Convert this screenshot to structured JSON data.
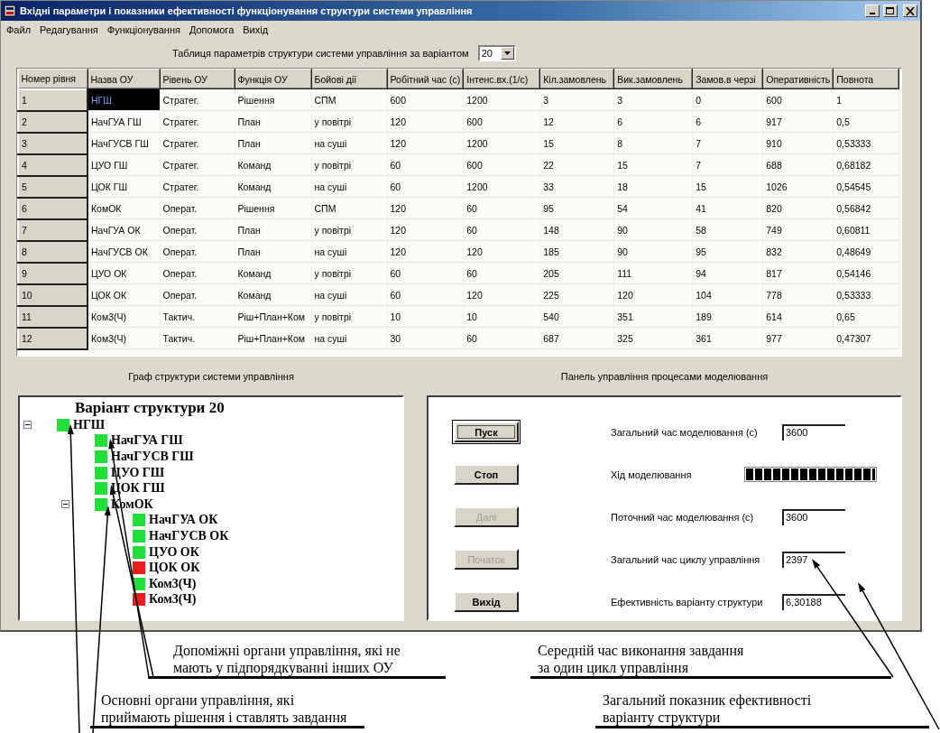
{
  "window": {
    "title": "Вхідні параметри і показники ефективності функціонування структури системи управління",
    "menu": [
      "Файл",
      "Редагування",
      "Функціонування",
      "Допомога",
      "Вихід"
    ]
  },
  "variant_selector": {
    "label": "Таблиця параметрів структури системи управління за варіантом",
    "value": "20"
  },
  "table": {
    "columns": [
      "Номер рівня",
      "Назва ОУ",
      "Рівень ОУ",
      "Функція ОУ",
      "Бойові дії",
      "Робітний час (с)",
      "Інтенс.вх.(1/с)",
      "Кіл.замовлень",
      "Вик.замовлень",
      "Замов.в черзі",
      "Оперативність",
      "Повнота"
    ],
    "rows": [
      {
        "selected": true,
        "cells": [
          "1",
          "НГШ",
          "Стратег.",
          "Рішення",
          "СПМ",
          "600",
          "1200",
          "3",
          "3",
          "0",
          "600",
          "1"
        ]
      },
      {
        "selected": false,
        "cells": [
          "2",
          "НачГУА ГШ",
          "Стратег.",
          "План",
          "у повітрі",
          "120",
          "600",
          "12",
          "6",
          "6",
          "917",
          "0,5"
        ]
      },
      {
        "selected": false,
        "cells": [
          "3",
          "НачГУСВ ГШ",
          "Стратег.",
          "План",
          "на суші",
          "120",
          "1200",
          "15",
          "8",
          "7",
          "910",
          "0,53333"
        ]
      },
      {
        "selected": false,
        "cells": [
          "4",
          "ЦУО ГШ",
          "Стратег.",
          "Команд",
          "у повітрі",
          "60",
          "600",
          "22",
          "15",
          "7",
          "688",
          "0,68182"
        ]
      },
      {
        "selected": false,
        "cells": [
          "5",
          "ЦОК ГШ",
          "Стратег.",
          "Команд",
          "на суші",
          "60",
          "1200",
          "33",
          "18",
          "15",
          "1026",
          "0,54545"
        ]
      },
      {
        "selected": false,
        "cells": [
          "6",
          "КомОК",
          "Операт.",
          "Рішення",
          "СПМ",
          "120",
          "60",
          "95",
          "54",
          "41",
          "820",
          "0,56842"
        ]
      },
      {
        "selected": false,
        "cells": [
          "7",
          "НачГУА ОК",
          "Операт.",
          "План",
          "у повітрі",
          "120",
          "60",
          "148",
          "90",
          "58",
          "749",
          "0,60811"
        ]
      },
      {
        "selected": false,
        "cells": [
          "8",
          "НачГУСВ ОК",
          "Операт.",
          "План",
          "на суші",
          "120",
          "120",
          "185",
          "90",
          "95",
          "832",
          "0,48649"
        ]
      },
      {
        "selected": false,
        "cells": [
          "9",
          "ЦУО ОК",
          "Операт.",
          "Команд",
          "у повітрі",
          "60",
          "60",
          "205",
          "111",
          "94",
          "817",
          "0,54146"
        ]
      },
      {
        "selected": false,
        "cells": [
          "10",
          "ЦОК ОК",
          "Операт.",
          "Команд",
          "на суші",
          "60",
          "120",
          "225",
          "120",
          "104",
          "778",
          "0,53333"
        ]
      },
      {
        "selected": false,
        "cells": [
          "11",
          "Ком3(Ч)",
          "Тактич.",
          "Ріш+План+Ком",
          "у повітрі",
          "10",
          "10",
          "540",
          "351",
          "189",
          "614",
          "0,65"
        ]
      },
      {
        "selected": false,
        "cells": [
          "12",
          "Ком3(Ч)",
          "Тактич.",
          "Ріш+План+Ком",
          "на суші",
          "30",
          "60",
          "687",
          "325",
          "361",
          "977",
          "0,47307"
        ]
      }
    ]
  },
  "graph_panel": {
    "title": "Граф структури системи управління",
    "tree": {
      "label": "Варіант структури 20",
      "children": [
        {
          "label": "НГШ",
          "color": "#22e03a",
          "expanded": true,
          "children": [
            {
              "label": "НачГУА ГШ",
              "color": "#22e03a"
            },
            {
              "label": "НачГУСВ ГШ",
              "color": "#22e03a"
            },
            {
              "label": "ЦУО ГШ",
              "color": "#22e03a"
            },
            {
              "label": "ЦОК ГШ",
              "color": "#22e03a"
            },
            {
              "label": "КомОК",
              "color": "#22e03a",
              "expanded": true,
              "children": [
                {
                  "label": "НачГУА ОК",
                  "color": "#22e03a"
                },
                {
                  "label": "НачГУСВ ОК",
                  "color": "#22e03a"
                },
                {
                  "label": "ЦУО ОК",
                  "color": "#22e03a"
                },
                {
                  "label": "ЦОК ОК",
                  "color": "#ee1c1c"
                },
                {
                  "label": "Ком3(Ч)",
                  "color": "#22e03a"
                },
                {
                  "label": "Ком3(Ч)",
                  "color": "#ee1c1c"
                }
              ]
            }
          ]
        }
      ]
    }
  },
  "control_panel": {
    "title": "Панель управління процесами моделювання",
    "buttons": [
      {
        "label": "Пуск",
        "disabled": false,
        "focused": true
      },
      {
        "label": "Стоп",
        "disabled": false,
        "focused": false
      },
      {
        "label": "Далі",
        "disabled": true,
        "focused": false
      },
      {
        "label": "Початок",
        "disabled": true,
        "focused": false
      },
      {
        "label": "Вихід",
        "disabled": false,
        "focused": false
      }
    ],
    "fields": [
      {
        "kind": "input",
        "label": "Загальний час моделювання (с)",
        "value": "3600"
      },
      {
        "kind": "progress",
        "label": "Хід моделювання",
        "level": 1
      },
      {
        "kind": "input",
        "label": "Поточний час моделювання (с)",
        "value": "3600"
      },
      {
        "kind": "input",
        "label": "Загальний час циклу управління",
        "value": "2397"
      },
      {
        "kind": "input",
        "label": "Ефективність варіанту структури",
        "value": "6,30188"
      }
    ]
  },
  "annotations": [
    {
      "text": "Допоміжні органи управління, які не\nмають у підпорядкуванні інших ОУ"
    },
    {
      "text": "Середній час виконання завдання\nза один цикл управління"
    },
    {
      "text": "Основні органи управління, які\nприймають рішення і ставлять завдання"
    },
    {
      "text": "Загальний показник ефективності\nваріанту структури"
    }
  ]
}
